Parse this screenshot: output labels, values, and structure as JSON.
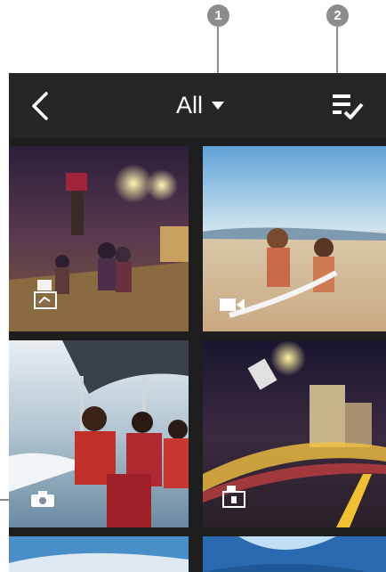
{
  "callouts": [
    "1",
    "2"
  ],
  "header": {
    "filter_label": "All",
    "back_icon": "chevron-left-icon",
    "select_icon": "multi-select-icon"
  },
  "tiles": [
    {
      "name": "night-street-photo",
      "type": "time-lapse"
    },
    {
      "name": "beach-couple-video",
      "type": "video"
    },
    {
      "name": "boat-group-photo",
      "type": "photo"
    },
    {
      "name": "city-night-lapse",
      "type": "time-lapse"
    },
    {
      "name": "sky-photo",
      "type": "photo"
    },
    {
      "name": "underwater-photo",
      "type": "photo"
    }
  ],
  "colors": {
    "header_bg": "#262626",
    "callout": "#8c8c8c",
    "screen_bg": "#1e1e1e"
  }
}
